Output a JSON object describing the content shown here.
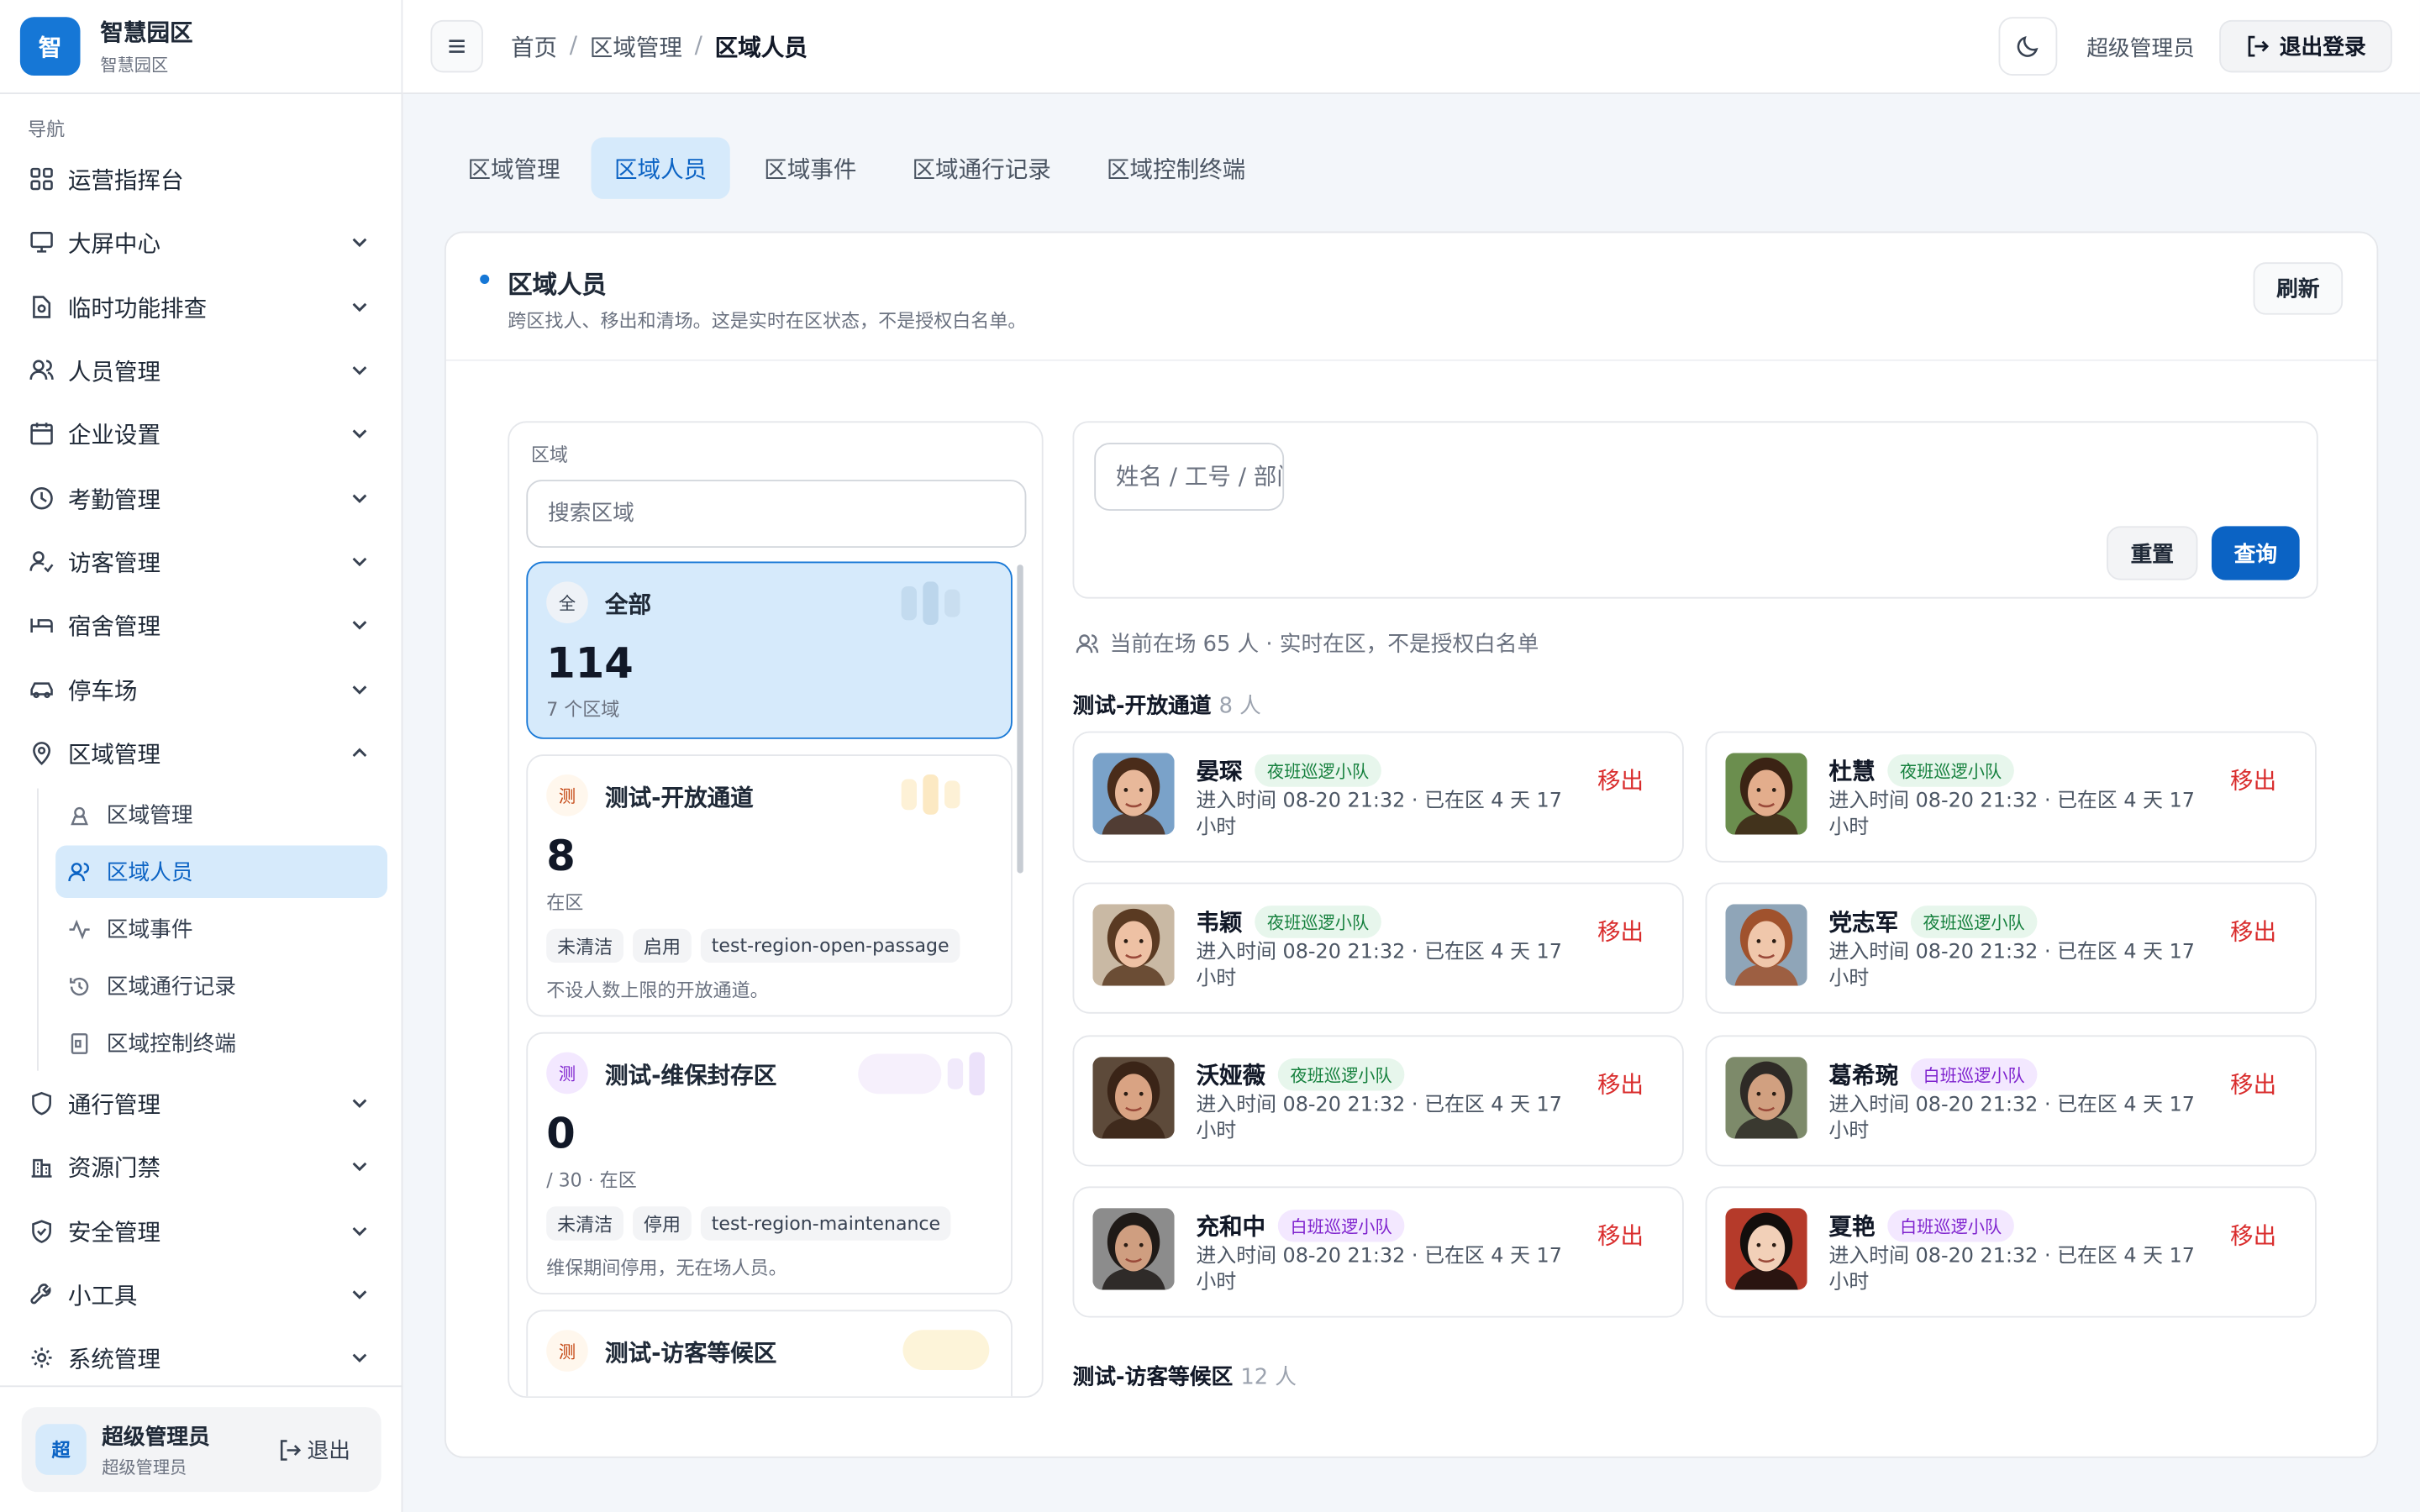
{
  "brand": {
    "logo": "智",
    "title": "智慧园区",
    "subtitle": "智慧园区"
  },
  "nav": {
    "caption": "导航",
    "items": [
      {
        "label": "运营指挥台",
        "icon": "dashboard-icon"
      },
      {
        "label": "大屏中心",
        "icon": "monitor-icon"
      },
      {
        "label": "临时功能排查",
        "icon": "file-search-icon"
      },
      {
        "label": "人员管理",
        "icon": "users-icon"
      },
      {
        "label": "企业设置",
        "icon": "calendar-icon"
      },
      {
        "label": "考勤管理",
        "icon": "clock-icon"
      },
      {
        "label": "访客管理",
        "icon": "user-check-icon"
      },
      {
        "label": "宿舍管理",
        "icon": "bed-icon"
      },
      {
        "label": "停车场",
        "icon": "car-icon"
      },
      {
        "label": "区域管理",
        "icon": "map-pin-icon"
      },
      {
        "label": "通行管理",
        "icon": "shield-icon"
      },
      {
        "label": "资源门禁",
        "icon": "building-icon"
      },
      {
        "label": "安全管理",
        "icon": "shield-check-icon"
      },
      {
        "label": "小工具",
        "icon": "wrench-icon"
      },
      {
        "label": "系统管理",
        "icon": "gear-icon"
      }
    ],
    "sub_items": [
      {
        "label": "区域管理",
        "icon": "region-icon"
      },
      {
        "label": "区域人员",
        "icon": "users-icon"
      },
      {
        "label": "区域事件",
        "icon": "activity-icon"
      },
      {
        "label": "区域通行记录",
        "icon": "history-icon"
      },
      {
        "label": "区域控制终端",
        "icon": "terminal-icon"
      }
    ]
  },
  "user_box": {
    "avatar": "超",
    "name": "超级管理员",
    "role": "超级管理员",
    "logout": "退出"
  },
  "header": {
    "breadcrumb": [
      "首页",
      "区域管理",
      "区域人员"
    ],
    "separator": "/",
    "user": "超级管理员",
    "logout": "退出登录"
  },
  "tabs": [
    "区域管理",
    "区域人员",
    "区域事件",
    "区域通行记录",
    "区域控制终端"
  ],
  "card": {
    "title": "区域人员",
    "desc": "跨区找人、移出和清场。这是实时在区状态，不是授权白名单。",
    "refresh": "刷新"
  },
  "region_panel": {
    "label": "区域",
    "search_placeholder": "搜索区域",
    "regions": [
      {
        "badge": "全",
        "name": "全部",
        "count": "114",
        "note": "7 个区域"
      },
      {
        "badge": "测",
        "name": "测试-开放通道",
        "count": "8",
        "note": "在区",
        "tags": [
          "未清洁",
          "启用",
          "test-region-open-passage"
        ],
        "desc": "不设人数上限的开放通道。"
      },
      {
        "badge": "测",
        "name": "测试-维保封存区",
        "count": "0",
        "note": "/ 30 · 在区",
        "tags": [
          "未清洁",
          "停用",
          "test-region-maintenance"
        ],
        "desc": "维保期间停用，无在场人员。"
      },
      {
        "badge": "测",
        "name": "测试-访客等候区"
      }
    ]
  },
  "search": {
    "name_placeholder": "姓名 / 工号 / 部门",
    "reset": "重置",
    "query": "查询"
  },
  "present": "当前在场 65 人 · 实时在区，不是授权白名单",
  "groups": [
    {
      "title": "测试-开放通道",
      "count": "8 人"
    },
    {
      "title": "测试-访客等候区",
      "count": "12 人"
    }
  ],
  "people": [
    {
      "name": "晏琛",
      "team": "夜班巡逻小队",
      "team_type": "night",
      "time": "进入时间 08-20 21:32 · 已在区 4 天 17 小时",
      "action": "移出",
      "skin": "#e8b89a",
      "hair": "#4a2c1a",
      "bg": "#7aa2c9"
    },
    {
      "name": "杜慧",
      "team": "夜班巡逻小队",
      "team_type": "night",
      "time": "进入时间 08-20 21:32 · 已在区 4 天 17 小时",
      "action": "移出",
      "skin": "#e3ad8c",
      "hair": "#3b2314",
      "bg": "#6b8e4e"
    },
    {
      "name": "韦颖",
      "team": "夜班巡逻小队",
      "team_type": "night",
      "time": "进入时间 08-20 21:32 · 已在区 4 天 17 小时",
      "action": "移出",
      "skin": "#eec1a4",
      "hair": "#5a3a22",
      "bg": "#c9b9a4"
    },
    {
      "name": "党志军",
      "team": "夜班巡逻小队",
      "team_type": "night",
      "time": "进入时间 08-20 21:32 · 已在区 4 天 17 小时",
      "action": "移出",
      "skin": "#f0c7ab",
      "hair": "#a0522d",
      "bg": "#8fa5b8"
    },
    {
      "name": "沃娅薇",
      "team": "夜班巡逻小队",
      "team_type": "night",
      "time": "进入时间 08-20 21:32 · 已在区 4 天 17 小时",
      "action": "移出",
      "skin": "#d9a383",
      "hair": "#3a2417",
      "bg": "#5d4a3a"
    },
    {
      "name": "葛希琬",
      "team": "白班巡逻小队",
      "team_type": "day",
      "time": "进入时间 08-20 21:32 · 已在区 4 天 17 小时",
      "action": "移出",
      "skin": "#d1a080",
      "hair": "#2e2a26",
      "bg": "#7d8a6a"
    },
    {
      "name": "充和中",
      "team": "白班巡逻小队",
      "team_type": "day",
      "time": "进入时间 08-20 21:32 · 已在区 4 天 17 小时",
      "action": "移出",
      "skin": "#cf9e80",
      "hair": "#1f1a17",
      "bg": "#8c8c8c"
    },
    {
      "name": "夏艳",
      "team": "白班巡逻小队",
      "team_type": "day",
      "time": "进入时间 08-20 21:32 · 已在区 4 天 17 小时",
      "action": "移出",
      "skin": "#f2d0b8",
      "hair": "#120e0c",
      "bg": "#b53a2a"
    }
  ],
  "colors": {
    "primary": "#0b63c4",
    "active_bg": "#d6eafb",
    "danger": "#d92c2c",
    "night_team": "#15803d",
    "day_team": "#7e22ce"
  }
}
